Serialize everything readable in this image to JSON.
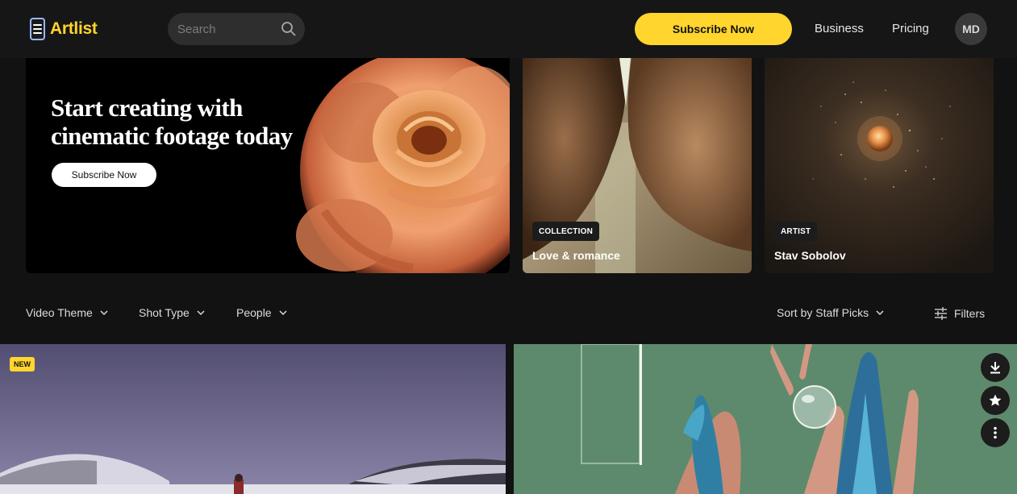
{
  "header": {
    "logo_text": "Artlist",
    "search_placeholder": "Search",
    "subscribe_label": "Subscribe Now",
    "nav": [
      "Business",
      "Pricing"
    ],
    "avatar_initials": "MD",
    "brand_color": "#ffd52e"
  },
  "hero": {
    "title": "Start creating with cinematic footage today",
    "cta_label": "Subscribe Now"
  },
  "cards": [
    {
      "tag": "COLLECTION",
      "title": "Love & romance"
    },
    {
      "tag": "ARTIST",
      "title": "Stav Sobolov"
    }
  ],
  "filters": {
    "video_theme": "Video Theme",
    "shot_type": "Shot Type",
    "people": "People",
    "sort": "Sort by Staff Picks",
    "filters_label": "Filters"
  },
  "tiles": {
    "new_badge": "NEW",
    "actions": [
      "download-icon",
      "star-icon",
      "more-icon"
    ]
  }
}
